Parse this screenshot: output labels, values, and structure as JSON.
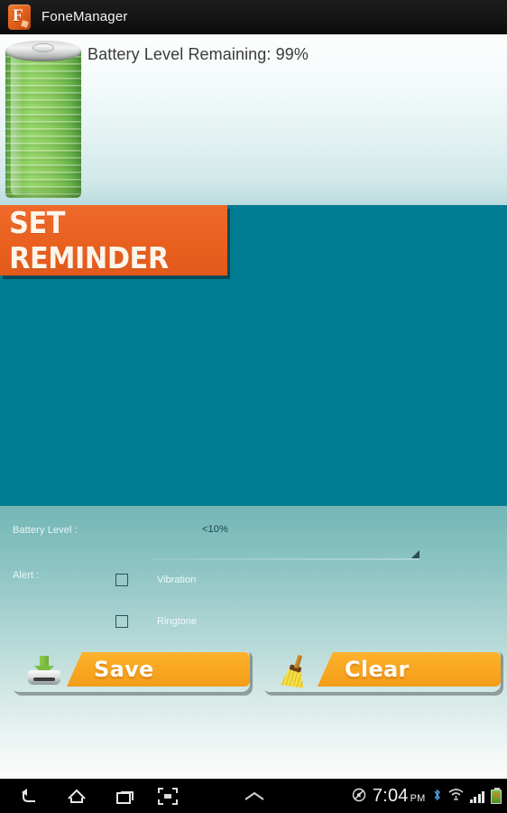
{
  "titlebar": {
    "app_name": "FoneManager",
    "icon": "phone-f-logo-icon",
    "bg_color": "#131313"
  },
  "status": {
    "battery_level_text": "Battery Level Remaining: 99%",
    "battery_percent": 99,
    "battery_graphic": "green-cylindrical-battery-icon"
  },
  "panel": {
    "bg_color": "#007b91",
    "banner": {
      "label": "SET REMINDER",
      "bg_color": "#e8621f",
      "text_color": "#fdf4ea"
    },
    "fields": {
      "battery_level_label": "Battery Level :",
      "battery_level_value": "<10%",
      "alert_label": "Alert :"
    },
    "checkboxes": [
      {
        "label": "Vibration",
        "checked": false
      },
      {
        "label": "Ringtone",
        "checked": false
      }
    ],
    "buttons": [
      {
        "label": "Save",
        "icon": "save-tray-icon",
        "accent": "#f9a621"
      },
      {
        "label": "Clear",
        "icon": "broom-icon",
        "accent": "#f9a621"
      }
    ]
  },
  "navbar": {
    "back": "back-icon",
    "home": "home-icon",
    "recents": "recent-apps-icon",
    "screenshot": "screenshot-icon",
    "expand": "chevron-up-icon",
    "status": {
      "mute": "mute-icon",
      "time": "7:04",
      "ampm": "PM",
      "bluetooth": "bluetooth-icon",
      "wifi": "wifi-icon",
      "signal": "signal-bars-icon",
      "battery": "battery-status-icon"
    }
  }
}
